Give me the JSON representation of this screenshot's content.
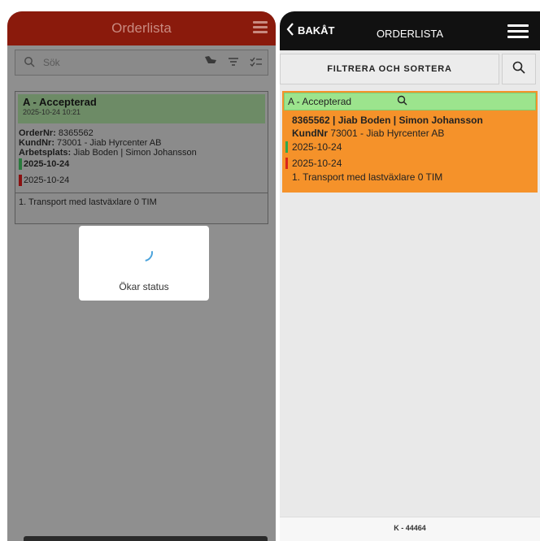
{
  "left": {
    "title": "Orderlista",
    "search_placeholder": "Sök",
    "card": {
      "status": "A - Accepterad",
      "timestamp": "2025-10-24 10:21",
      "ordernr_label": "OrderNr:",
      "ordernr": " 8365562",
      "kundnr_label": "KundNr:",
      "kundnr": " 73001 - Jiab Hyrcenter AB",
      "arbetsplats_label": "Arbetsplats:",
      "arbetsplats": " Jiab Boden | Simon Johansson",
      "date_start": "2025-10-24",
      "date_end": "2025-10-24",
      "line_item": "1. Transport med lastväxlare 0 TIM"
    },
    "modal": {
      "label": "Ökar status"
    }
  },
  "right": {
    "back_label": "BAKÅT",
    "title": "ORDERLISTA",
    "filter_label": "FILTRERA OCH SORTERA",
    "card": {
      "status": "A - Accepterad",
      "line1": "8365562 | Jiab Boden | Simon Johansson",
      "kundnr_label": "KundNr",
      "kundnr": " 73001 - Jiab Hyrcenter AB",
      "date_start": "2025-10-24",
      "date_end": "2025-10-24",
      "line_item": "1. Transport med lastväxlare 0 TIM"
    },
    "footer": "K - 44464"
  },
  "colors": {
    "left_header": "#8a1a0c",
    "right_header": "#111111",
    "card_orange": "#f5922a",
    "status_green": "#9ce48d",
    "start_bar": "#2fa84f",
    "end_bar": "#d7261b",
    "spinner": "#4aa3dc"
  },
  "icons": [
    "menu-icon",
    "search-icon",
    "hand-icon",
    "filter-icon",
    "checklist-icon",
    "back-chevron-icon",
    "spinner-icon"
  ]
}
